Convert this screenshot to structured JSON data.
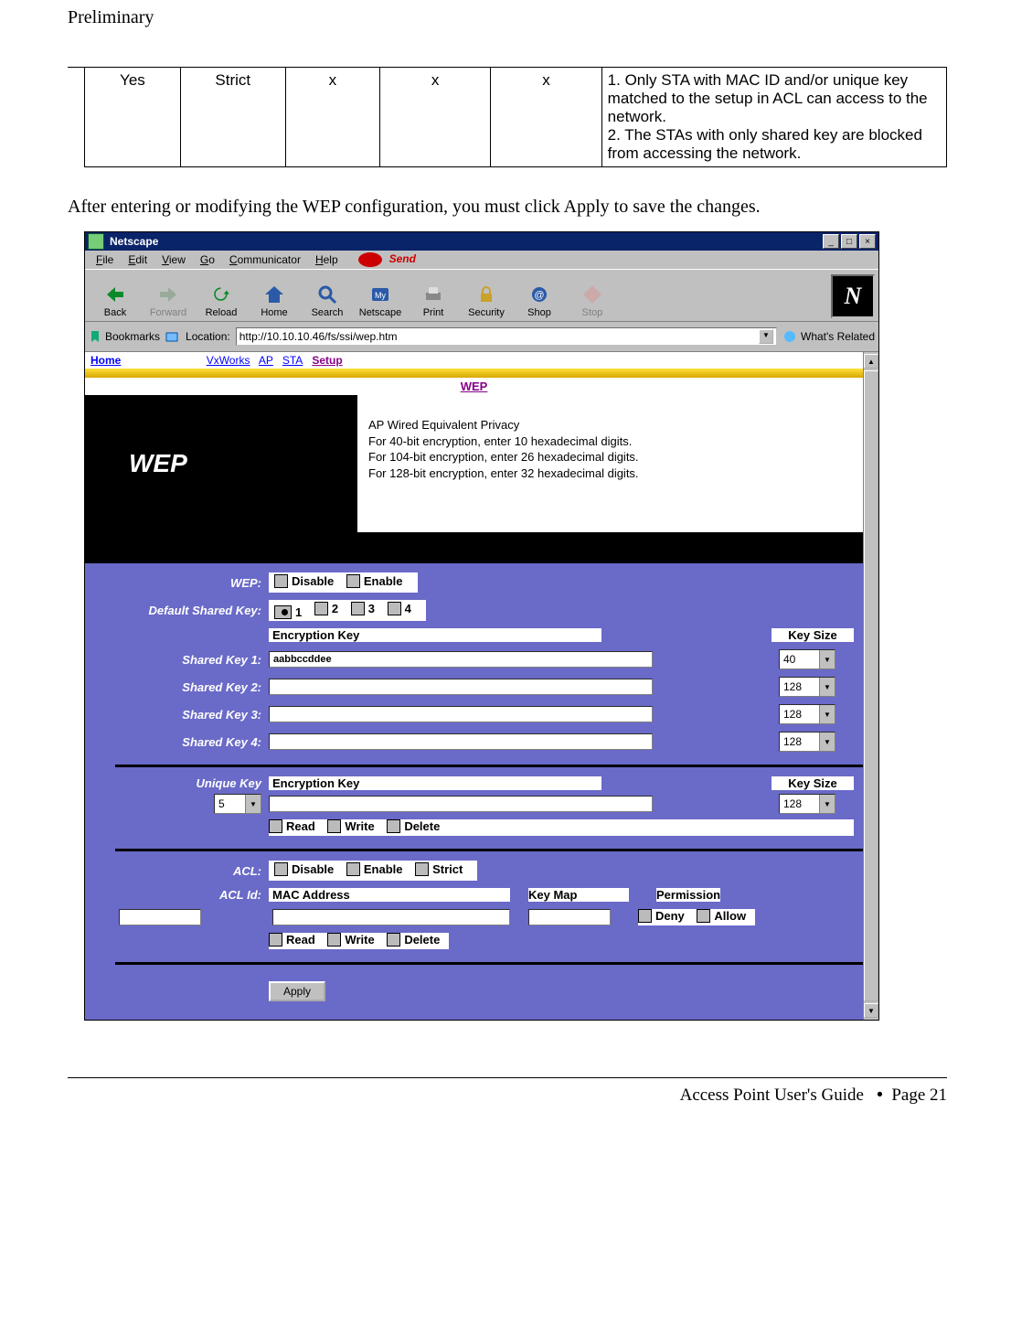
{
  "page_header": "Preliminary",
  "doc_table": {
    "cells": [
      "Yes",
      "Strict",
      "x",
      "x",
      "x"
    ],
    "desc": "1. Only STA with MAC ID and/or unique key matched to the setup in ACL can access to the network.\n2. The STAs with only shared key are blocked from accessing the network."
  },
  "paragraph": "After entering or modifying the WEP configuration, you must click Apply to save the changes.",
  "window": {
    "title": "Netscape",
    "menus": [
      "File",
      "Edit",
      "View",
      "Go",
      "Communicator",
      "Help"
    ],
    "send": "Send",
    "toolbar": [
      {
        "name": "back",
        "label": "Back",
        "dis": false
      },
      {
        "name": "forward",
        "label": "Forward",
        "dis": true
      },
      {
        "name": "reload",
        "label": "Reload",
        "dis": false
      },
      {
        "name": "home",
        "label": "Home",
        "dis": false
      },
      {
        "name": "search",
        "label": "Search",
        "dis": false
      },
      {
        "name": "netscape",
        "label": "Netscape",
        "dis": false
      },
      {
        "name": "print",
        "label": "Print",
        "dis": false
      },
      {
        "name": "security",
        "label": "Security",
        "dis": false
      },
      {
        "name": "shop",
        "label": "Shop",
        "dis": false
      },
      {
        "name": "stop",
        "label": "Stop",
        "dis": true
      }
    ],
    "bookmarks_label": "Bookmarks",
    "location_label": "Location:",
    "location_value": "http://10.10.10.46/fs/ssi/wep.htm",
    "related": "What's Related",
    "nlogo": "N"
  },
  "toplinks": {
    "home": "Home",
    "vx": "VxWorks",
    "ap": "AP",
    "sta": "STA",
    "setup": "Setup",
    "wep": "WEP"
  },
  "hero": {
    "title": "WEP",
    "lines": [
      "AP Wired Equivalent Privacy",
      "For 40-bit encryption, enter 10 hexadecimal digits.",
      "For 104-bit encryption, enter 26 hexadecimal digits.",
      "For 128-bit encryption, enter 32 hexadecimal digits."
    ]
  },
  "form": {
    "wep_label": "WEP:",
    "wep_opts": [
      "Disable",
      "Enable"
    ],
    "dsk_label": "Default Shared Key:",
    "dsk_opts": [
      "1",
      "2",
      "3",
      "4"
    ],
    "enc_hdr": "Encryption Key",
    "ks_hdr": "Key Size",
    "keys": [
      {
        "label": "Shared Key 1:",
        "val": "aabbccddee",
        "size": "40"
      },
      {
        "label": "Shared Key 2:",
        "val": "",
        "size": "128"
      },
      {
        "label": "Shared Key 3:",
        "val": "",
        "size": "128"
      },
      {
        "label": "Shared Key 4:",
        "val": "",
        "size": "128"
      }
    ],
    "uk_label": "Unique Key",
    "uk_sel": "5",
    "uk_val": "",
    "uk_size": "128",
    "rwd": [
      "Read",
      "Write",
      "Delete"
    ],
    "acl_label": "ACL:",
    "acl_opts": [
      "Disable",
      "Enable",
      "Strict"
    ],
    "aclid_label": "ACL Id:",
    "mac_hdr": "MAC Address",
    "km_hdr": "Key Map",
    "perm_hdr": "Permission",
    "perm_opts": [
      "Deny",
      "Allow"
    ],
    "apply": "Apply"
  },
  "footer": {
    "guide": "Access Point User's Guide",
    "page": "Page 21",
    "bullet": "•"
  }
}
